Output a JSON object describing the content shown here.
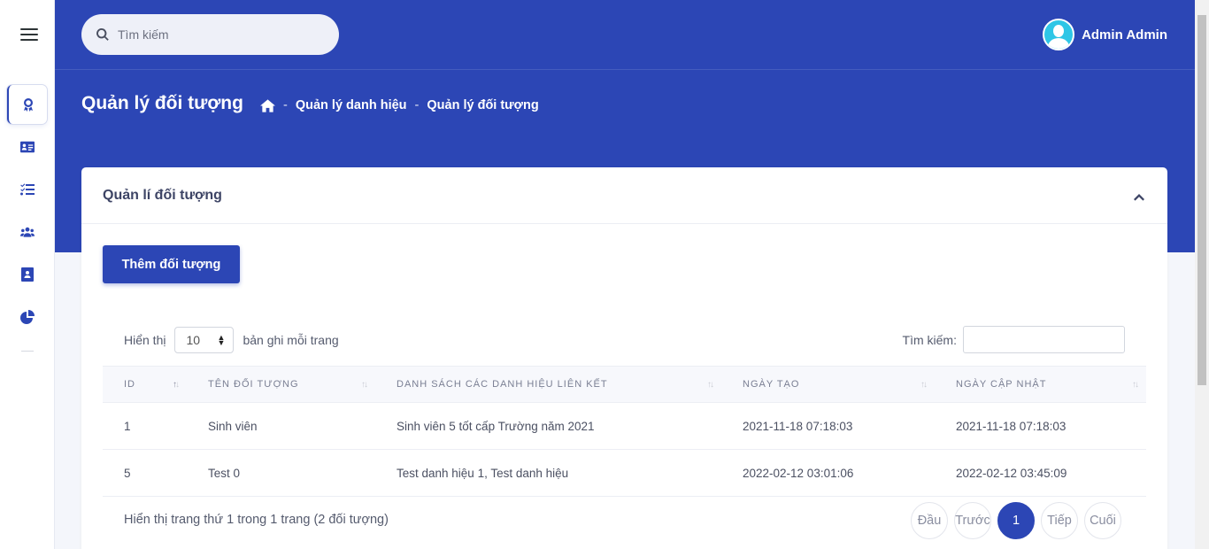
{
  "search": {
    "placeholder": "Tìm kiếm",
    "icon": "search-icon"
  },
  "user": {
    "name": "Admin Admin"
  },
  "header": {
    "title": "Quản lý đối tượng",
    "breadcrumb": [
      "Quản lý danh hiệu",
      "Quản lý đối tượng"
    ],
    "separator": "-"
  },
  "sidebar": {
    "items": [
      {
        "icon": "award-icon",
        "active": true
      },
      {
        "icon": "id-card-icon"
      },
      {
        "icon": "tasks-icon"
      },
      {
        "icon": "users-icon"
      },
      {
        "icon": "address-book-icon"
      },
      {
        "icon": "pie-chart-icon"
      }
    ]
  },
  "card": {
    "title": "Quản lí đối tượng",
    "add_button": "Thêm đối tượng",
    "length": {
      "prefix": "Hiển thị",
      "value": "10",
      "suffix": "bản ghi mỗi trang"
    },
    "filter_label": "Tìm kiếm:",
    "columns": [
      "ID",
      "TÊN ĐỐI TƯỢNG",
      "DANH SÁCH CÁC DANH HIỆU LIÊN KẾT",
      "NGÀY TẠO",
      "NGÀY CẬP NHẬT"
    ],
    "rows": [
      [
        "1",
        "Sinh viên",
        "Sinh viên 5 tốt cấp Trường năm 2021",
        "2021-11-18 07:18:03",
        "2021-11-18 07:18:03"
      ],
      [
        "5",
        "Test 0",
        "Test danh hiệu 1, Test danh hiệu",
        "2022-02-12 03:01:06",
        "2022-02-12 03:45:09"
      ]
    ],
    "info": "Hiển thị trang thứ 1 trong 1 trang (2 đối tượng)",
    "pager": {
      "first": "Đầu",
      "prev": "Trước",
      "current": "1",
      "next": "Tiếp",
      "last": "Cuối"
    }
  },
  "colors": {
    "primary": "#2c46b5",
    "avatar": "#2ec6e6"
  }
}
